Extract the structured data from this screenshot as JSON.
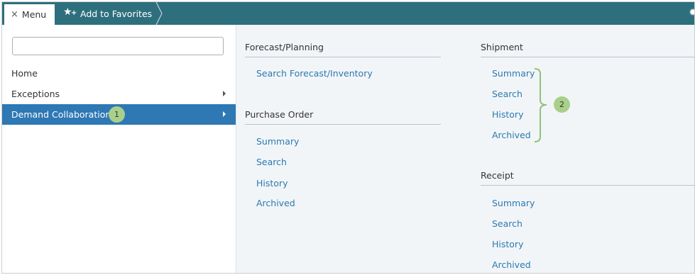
{
  "topbar": {
    "menu_label": "Menu",
    "menu_icon": "close-icon",
    "favorites_label": "Add to Favorites",
    "favorites_icon": "star-plus-icon",
    "settings_icon": "gear-icon"
  },
  "left": {
    "search_value": "",
    "items": [
      {
        "label": "Home",
        "has_arrow": false,
        "active": false
      },
      {
        "label": "Exceptions",
        "has_arrow": true,
        "active": false
      },
      {
        "label": "Demand Collaboration",
        "has_arrow": true,
        "active": true
      }
    ],
    "callout_1": "1"
  },
  "forecast": {
    "title": "Forecast/Planning",
    "links": [
      "Search Forecast/Inventory"
    ]
  },
  "purchase_order": {
    "title": "Purchase Order",
    "links": [
      "Summary",
      "Search",
      "History",
      "Archived"
    ]
  },
  "shipment": {
    "title": "Shipment",
    "links": [
      "Summary",
      "Search",
      "History",
      "Archived"
    ],
    "callout_2": "2"
  },
  "receipt": {
    "title": "Receipt",
    "links": [
      "Summary",
      "Search",
      "History",
      "Archived"
    ]
  },
  "colors": {
    "topbar": "#2e6f7e",
    "active_item": "#2e78b4",
    "link": "#2a7ab0",
    "callout": "#a9cf8b"
  }
}
